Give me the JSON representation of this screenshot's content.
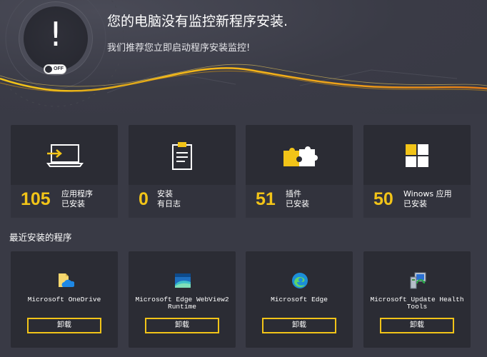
{
  "hero": {
    "title": "您的电脑没有监控新程序安装.",
    "subtitle": "我们推荐您立即启动程序安装监控!",
    "alert_mark": "!",
    "toggle_label": "OFF"
  },
  "stats": [
    {
      "number": "105",
      "label_line1": "应用程序",
      "label_line2": "已安装",
      "icon": "monitor-arrow-icon"
    },
    {
      "number": "0",
      "label_line1": "安装",
      "label_line2": "有日志",
      "icon": "clipboard-icon"
    },
    {
      "number": "51",
      "label_line1": "插件",
      "label_line2": "已安装",
      "icon": "puzzle-icon"
    },
    {
      "number": "50",
      "label_line1": "Winows 应用",
      "label_line2": "已安装",
      "icon": "windows-tiles-icon"
    }
  ],
  "recent": {
    "title": "最近安装的程序",
    "uninstall_label": "卸载",
    "apps": [
      {
        "name": "Microsoft OneDrive",
        "icon": "onedrive-icon"
      },
      {
        "name": "Microsoft Edge WebView2 Runtime",
        "icon": "edge-webview2-icon"
      },
      {
        "name": "Microsoft Edge",
        "icon": "edge-icon"
      },
      {
        "name": "Microsoft Update Health Tools",
        "icon": "update-health-tools-icon"
      }
    ]
  },
  "colors": {
    "accent": "#f2c418",
    "background": "#393a45",
    "card": "#2b2c34",
    "card_bottom": "#32333d"
  }
}
